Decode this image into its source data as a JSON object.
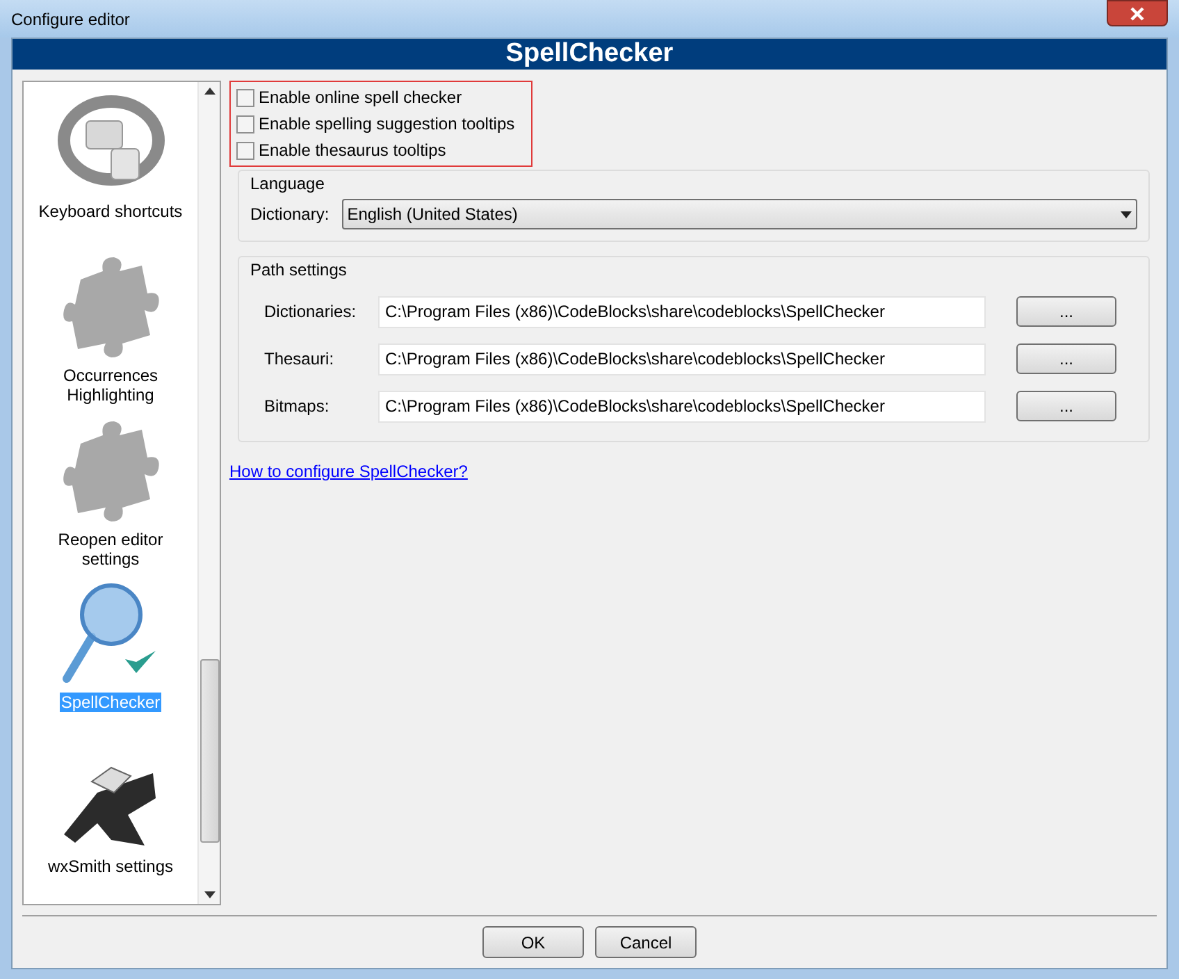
{
  "window": {
    "title": "Configure editor"
  },
  "header": {
    "title": "SpellChecker"
  },
  "sidebar": {
    "items": [
      {
        "label": "Keyboard shortcuts",
        "kind": "keyboard",
        "selected": false
      },
      {
        "label": "Occurrences Highlighting",
        "kind": "puzzle",
        "selected": false
      },
      {
        "label": "Reopen editor settings",
        "kind": "puzzle",
        "selected": false
      },
      {
        "label": "SpellChecker",
        "kind": "spell",
        "selected": true
      },
      {
        "label": "wxSmith settings",
        "kind": "wxsmith",
        "selected": false
      }
    ]
  },
  "options": [
    {
      "label": "Enable online spell checker",
      "checked": false
    },
    {
      "label": "Enable spelling suggestion tooltips",
      "checked": false
    },
    {
      "label": "Enable thesaurus tooltips",
      "checked": false
    }
  ],
  "language": {
    "title": "Language",
    "label": "Dictionary:",
    "value": "English (United States)"
  },
  "paths": {
    "title": "Path settings",
    "rows": [
      {
        "label": "Dictionaries:",
        "value": "C:\\Program Files (x86)\\CodeBlocks\\share\\codeblocks\\SpellChecker",
        "button": "..."
      },
      {
        "label": "Thesauri:",
        "value": "C:\\Program Files (x86)\\CodeBlocks\\share\\codeblocks\\SpellChecker",
        "button": "..."
      },
      {
        "label": "Bitmaps:",
        "value": "C:\\Program Files (x86)\\CodeBlocks\\share\\codeblocks\\SpellChecker",
        "button": "..."
      }
    ]
  },
  "link": "How to configure SpellChecker?",
  "buttons": [
    "OK",
    "Cancel"
  ]
}
